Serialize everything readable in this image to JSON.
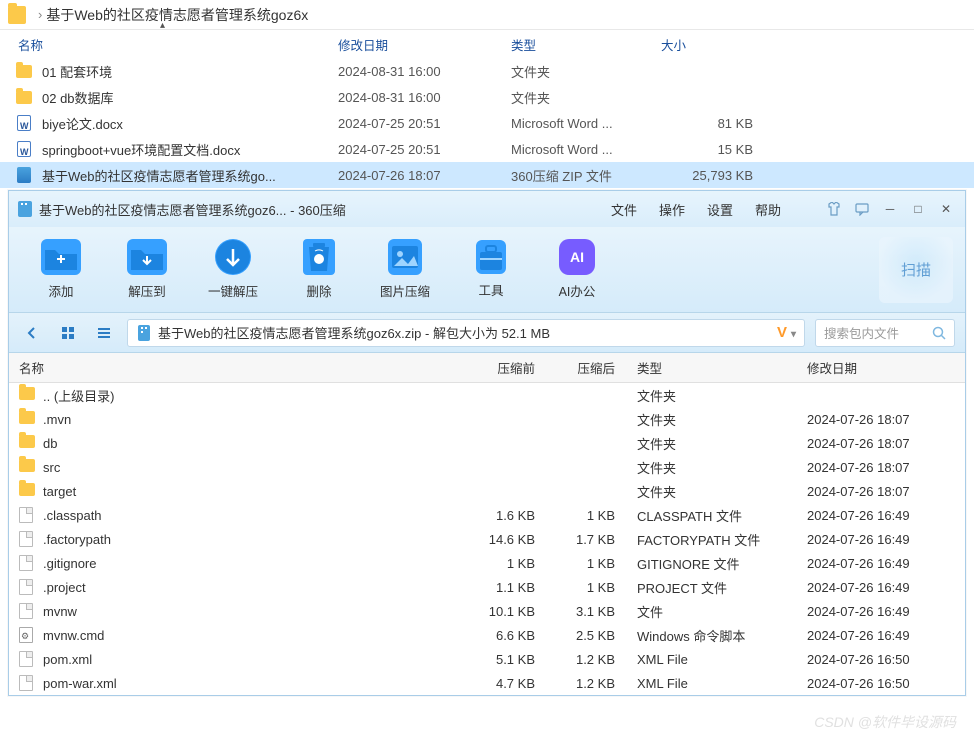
{
  "explorer": {
    "breadcrumb_sep": "›",
    "breadcrumb": "基于Web的社区疫情志愿者管理系统goz6x",
    "columns": {
      "name": "名称",
      "date": "修改日期",
      "type": "类型",
      "size": "大小"
    },
    "rows": [
      {
        "icon": "folder",
        "name": "01 配套环境",
        "date": "2024-08-31 16:00",
        "type": "文件夹",
        "size": ""
      },
      {
        "icon": "folder",
        "name": "02 db数据库",
        "date": "2024-08-31 16:00",
        "type": "文件夹",
        "size": ""
      },
      {
        "icon": "doc",
        "name": "biye论文.docx",
        "date": "2024-07-25 20:51",
        "type": "Microsoft Word ...",
        "size": "81 KB"
      },
      {
        "icon": "doc",
        "name": "springboot+vue环境配置文档.docx",
        "date": "2024-07-25 20:51",
        "type": "Microsoft Word ...",
        "size": "15 KB"
      },
      {
        "icon": "zip",
        "name": "基于Web的社区疫情志愿者管理系统go...",
        "date": "2024-07-26 18:07",
        "type": "360压缩 ZIP 文件",
        "size": "25,793 KB",
        "selected": true
      }
    ]
  },
  "zip": {
    "title": "基于Web的社区疫情志愿者管理系统goz6... - 360压缩",
    "menus": {
      "file": "文件",
      "op": "操作",
      "set": "设置",
      "help": "帮助"
    },
    "toolbar": {
      "add": "添加",
      "extract": "解压到",
      "oneclick": "一键解压",
      "delete": "删除",
      "piccomp": "图片压缩",
      "tools": "工具",
      "ai": "AI办公",
      "ai_badge": "AI",
      "scan": "扫描"
    },
    "pathbar": {
      "zipname": "基于Web的社区疫情志愿者管理系统goz6x.zip - 解包大小为 52.1 MB",
      "v": "V",
      "search_placeholder": "搜索包内文件"
    },
    "columns": {
      "name": "名称",
      "pre": "压缩前",
      "post": "压缩后",
      "type": "类型",
      "date": "修改日期"
    },
    "rows": [
      {
        "icon": "folder",
        "name": ".. (上级目录)",
        "pre": "",
        "post": "",
        "type": "文件夹",
        "date": ""
      },
      {
        "icon": "folder",
        "name": ".mvn",
        "pre": "",
        "post": "",
        "type": "文件夹",
        "date": "2024-07-26 18:07"
      },
      {
        "icon": "folder",
        "name": "db",
        "pre": "",
        "post": "",
        "type": "文件夹",
        "date": "2024-07-26 18:07"
      },
      {
        "icon": "folder",
        "name": "src",
        "pre": "",
        "post": "",
        "type": "文件夹",
        "date": "2024-07-26 18:07"
      },
      {
        "icon": "folder",
        "name": "target",
        "pre": "",
        "post": "",
        "type": "文件夹",
        "date": "2024-07-26 18:07"
      },
      {
        "icon": "file",
        "name": ".classpath",
        "pre": "1.6 KB",
        "post": "1 KB",
        "type": "CLASSPATH 文件",
        "date": "2024-07-26 16:49"
      },
      {
        "icon": "file",
        "name": ".factorypath",
        "pre": "14.6 KB",
        "post": "1.7 KB",
        "type": "FACTORYPATH 文件",
        "date": "2024-07-26 16:49"
      },
      {
        "icon": "file",
        "name": ".gitignore",
        "pre": "1 KB",
        "post": "1 KB",
        "type": "GITIGNORE 文件",
        "date": "2024-07-26 16:49"
      },
      {
        "icon": "file",
        "name": ".project",
        "pre": "1.1 KB",
        "post": "1 KB",
        "type": "PROJECT 文件",
        "date": "2024-07-26 16:49"
      },
      {
        "icon": "file",
        "name": "mvnw",
        "pre": "10.1 KB",
        "post": "3.1 KB",
        "type": "文件",
        "date": "2024-07-26 16:49"
      },
      {
        "icon": "cmd",
        "name": "mvnw.cmd",
        "pre": "6.6 KB",
        "post": "2.5 KB",
        "type": "Windows 命令脚本",
        "date": "2024-07-26 16:49"
      },
      {
        "icon": "file",
        "name": "pom.xml",
        "pre": "5.1 KB",
        "post": "1.2 KB",
        "type": "XML File",
        "date": "2024-07-26 16:50"
      },
      {
        "icon": "file",
        "name": "pom-war.xml",
        "pre": "4.7 KB",
        "post": "1.2 KB",
        "type": "XML File",
        "date": "2024-07-26 16:50"
      }
    ]
  },
  "watermark": "CSDN @软件毕设源码"
}
